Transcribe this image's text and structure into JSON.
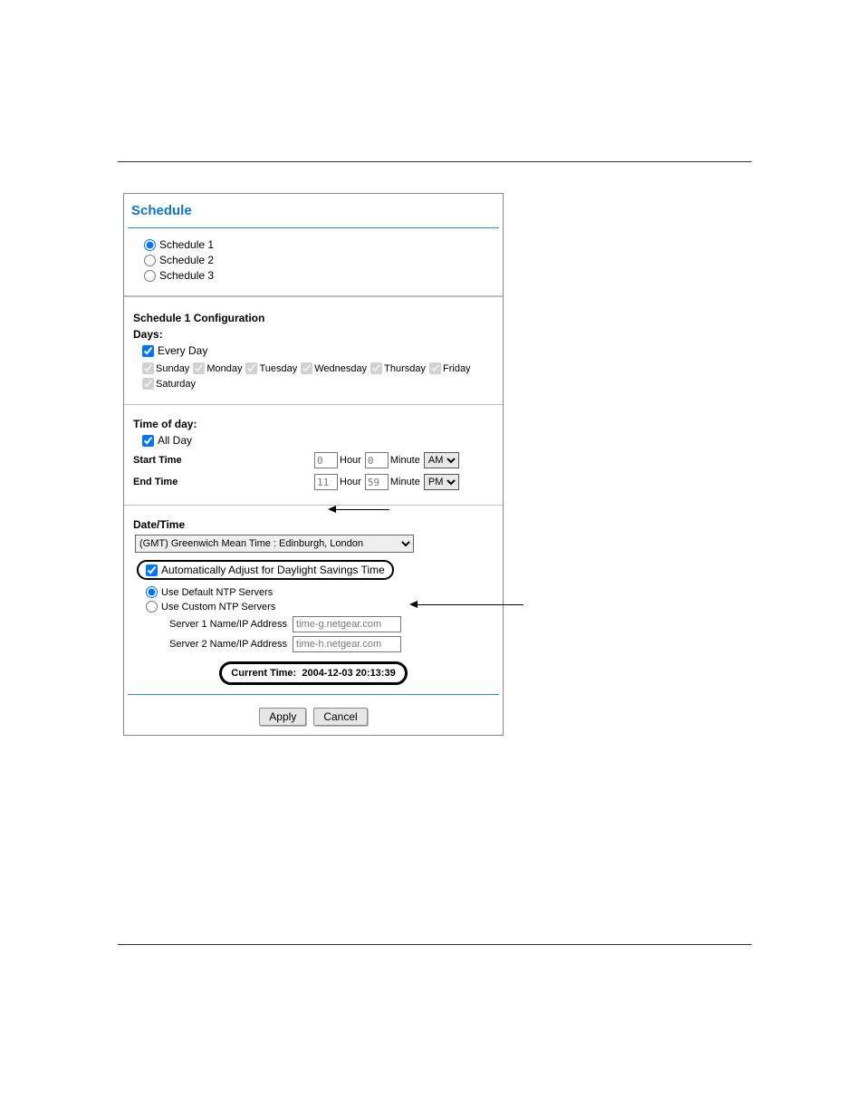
{
  "panel": {
    "title": "Schedule"
  },
  "schedules": {
    "options": [
      "Schedule 1",
      "Schedule 2",
      "Schedule 3"
    ]
  },
  "config": {
    "heading": "Schedule 1 Configuration",
    "days_label": "Days:",
    "every_day": "Every Day",
    "days": [
      "Sunday",
      "Monday",
      "Tuesday",
      "Wednesday",
      "Thursday",
      "Friday",
      "Saturday"
    ]
  },
  "time": {
    "heading": "Time of day:",
    "all_day": "All Day",
    "start_label": "Start Time",
    "end_label": "End Time",
    "hour_lbl": "Hour",
    "minute_lbl": "Minute",
    "start": {
      "hour": "0",
      "minute": "0",
      "ampm": "AM"
    },
    "end": {
      "hour": "11",
      "minute": "59",
      "ampm": "PM"
    }
  },
  "datetime": {
    "heading": "Date/Time",
    "timezone": "(GMT) Greenwich Mean Time : Edinburgh, London",
    "dst_label": "Automatically Adjust for Daylight Savings Time",
    "ntp_default": "Use Default NTP Servers",
    "ntp_custom": "Use Custom NTP Servers",
    "server1_label": "Server 1 Name/IP Address",
    "server1_value": "time-g.netgear.com",
    "server2_label": "Server 2 Name/IP Address",
    "server2_value": "time-h.netgear.com",
    "current_time_label": "Current Time:",
    "current_time_value": "2004-12-03 20:13:39"
  },
  "buttons": {
    "apply": "Apply",
    "cancel": "Cancel"
  }
}
